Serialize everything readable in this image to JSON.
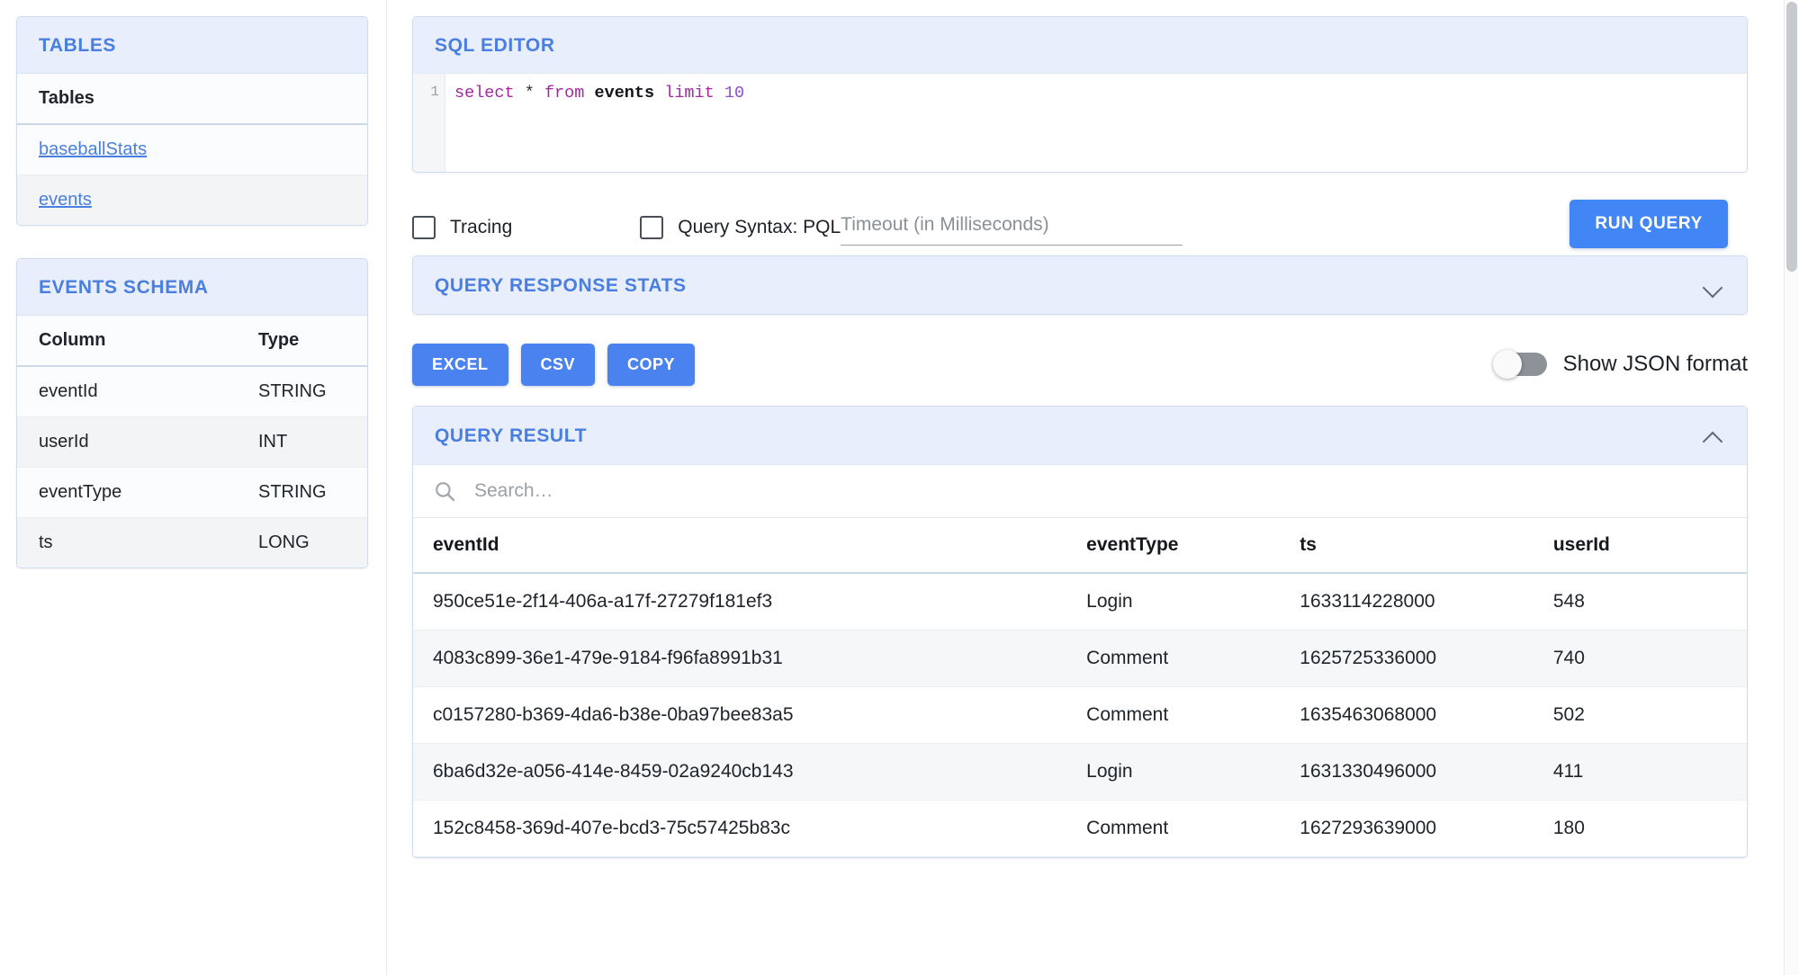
{
  "sidebar": {
    "tables_panel": {
      "title": "TABLES",
      "header": "Tables",
      "items": [
        {
          "label": "baseballStats"
        },
        {
          "label": "events"
        }
      ]
    },
    "schema_panel": {
      "title": "EVENTS SCHEMA",
      "columns": [
        "Column",
        "Type"
      ],
      "rows": [
        {
          "column": "eventId",
          "type": "STRING"
        },
        {
          "column": "userId",
          "type": "INT"
        },
        {
          "column": "eventType",
          "type": "STRING"
        },
        {
          "column": "ts",
          "type": "LONG"
        }
      ]
    }
  },
  "editor": {
    "title": "SQL EDITOR",
    "line_number": "1",
    "query_tokens": {
      "select": "select",
      "star": "*",
      "from": "from",
      "table": "events",
      "limit": "limit",
      "count": "10"
    },
    "query_text": "select * from events limit 10"
  },
  "controls": {
    "tracing_label": "Tracing",
    "query_syntax_label": "Query Syntax: PQL",
    "timeout_placeholder": "Timeout (in Milliseconds)",
    "timeout_value": "",
    "run_query_label": "RUN QUERY",
    "tracing_checked": false,
    "pql_checked": false
  },
  "stats_panel": {
    "title": "QUERY RESPONSE STATS",
    "collapsed": true
  },
  "export": {
    "excel_label": "EXCEL",
    "csv_label": "CSV",
    "copy_label": "COPY",
    "json_toggle_label": "Show JSON format",
    "json_toggle_on": false
  },
  "result_panel": {
    "title": "QUERY RESULT",
    "collapsed": false,
    "search_placeholder": "Search…",
    "search_value": "",
    "columns": [
      "eventId",
      "eventType",
      "ts",
      "userId"
    ],
    "rows": [
      {
        "eventId": "950ce51e-2f14-406a-a17f-27279f181ef3",
        "eventType": "Login",
        "ts": "1633114228000",
        "userId": "548"
      },
      {
        "eventId": "4083c899-36e1-479e-9184-f96fa8991b31",
        "eventType": "Comment",
        "ts": "1625725336000",
        "userId": "740"
      },
      {
        "eventId": "c0157280-b369-4da6-b38e-0ba97bee83a5",
        "eventType": "Comment",
        "ts": "1635463068000",
        "userId": "502"
      },
      {
        "eventId": "6ba6d32e-a056-414e-8459-02a9240cb143",
        "eventType": "Login",
        "ts": "1631330496000",
        "userId": "411"
      },
      {
        "eventId": "152c8458-369d-407e-bcd3-75c57425b83c",
        "eventType": "Comment",
        "ts": "1627293639000",
        "userId": "180"
      }
    ]
  },
  "colors": {
    "accent_blue": "#4a7fe0",
    "button_blue": "#4285f4",
    "header_bg": "#e8eefb",
    "keyword_purple": "#a626a4"
  }
}
